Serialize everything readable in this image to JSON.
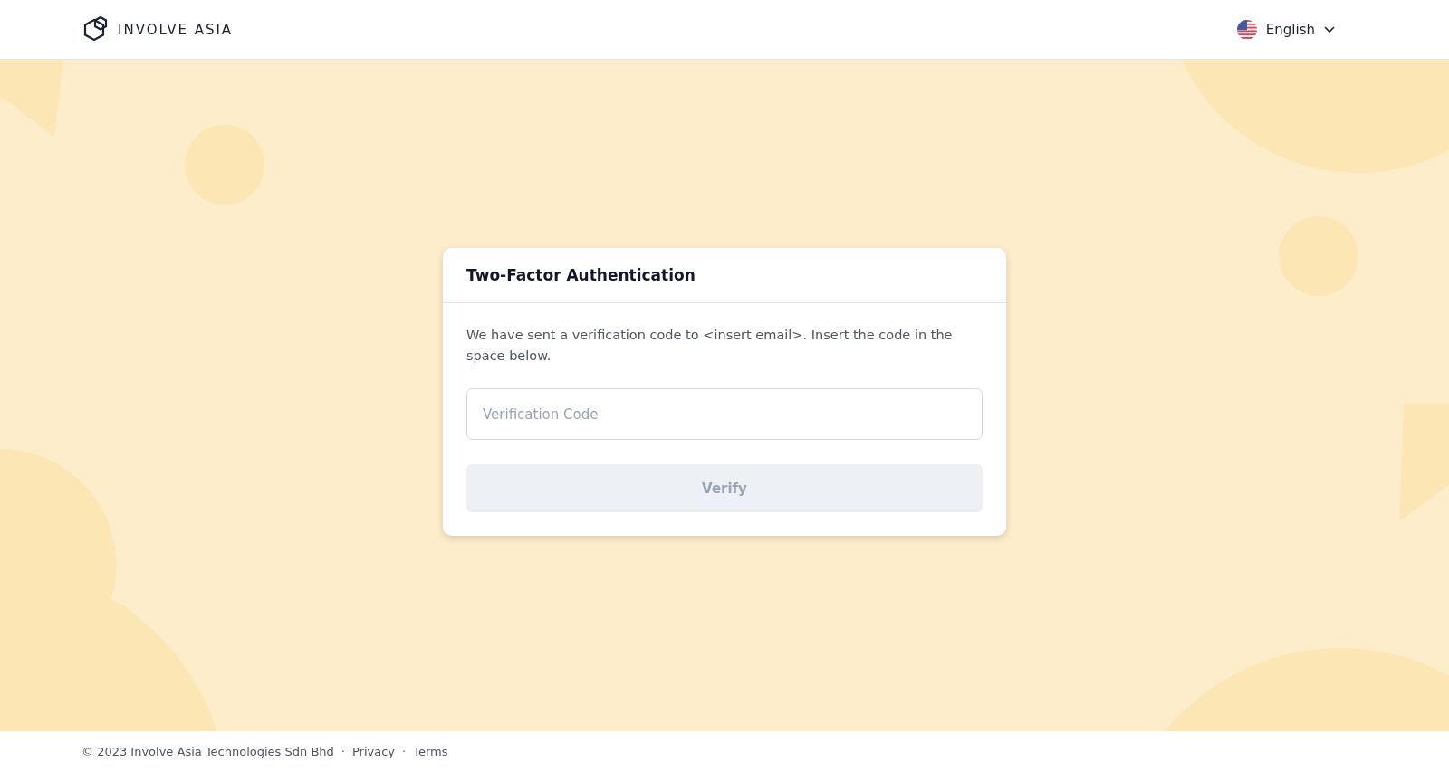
{
  "header": {
    "logo_text": "INVOLVE ASIA",
    "language": {
      "label": "English"
    }
  },
  "card": {
    "title": "Two-Factor Authentication",
    "message": "We have sent a verification code to <insert email>. Insert the code in the space below.",
    "field": {
      "placeholder": "Verification Code"
    },
    "button": {
      "label": "Verify",
      "disabled": true
    }
  },
  "footer": {
    "copyright": "© 2023 Involve Asia Technologies Sdn Bhd",
    "separator": "·",
    "links": [
      "Privacy",
      "Terms"
    ]
  }
}
